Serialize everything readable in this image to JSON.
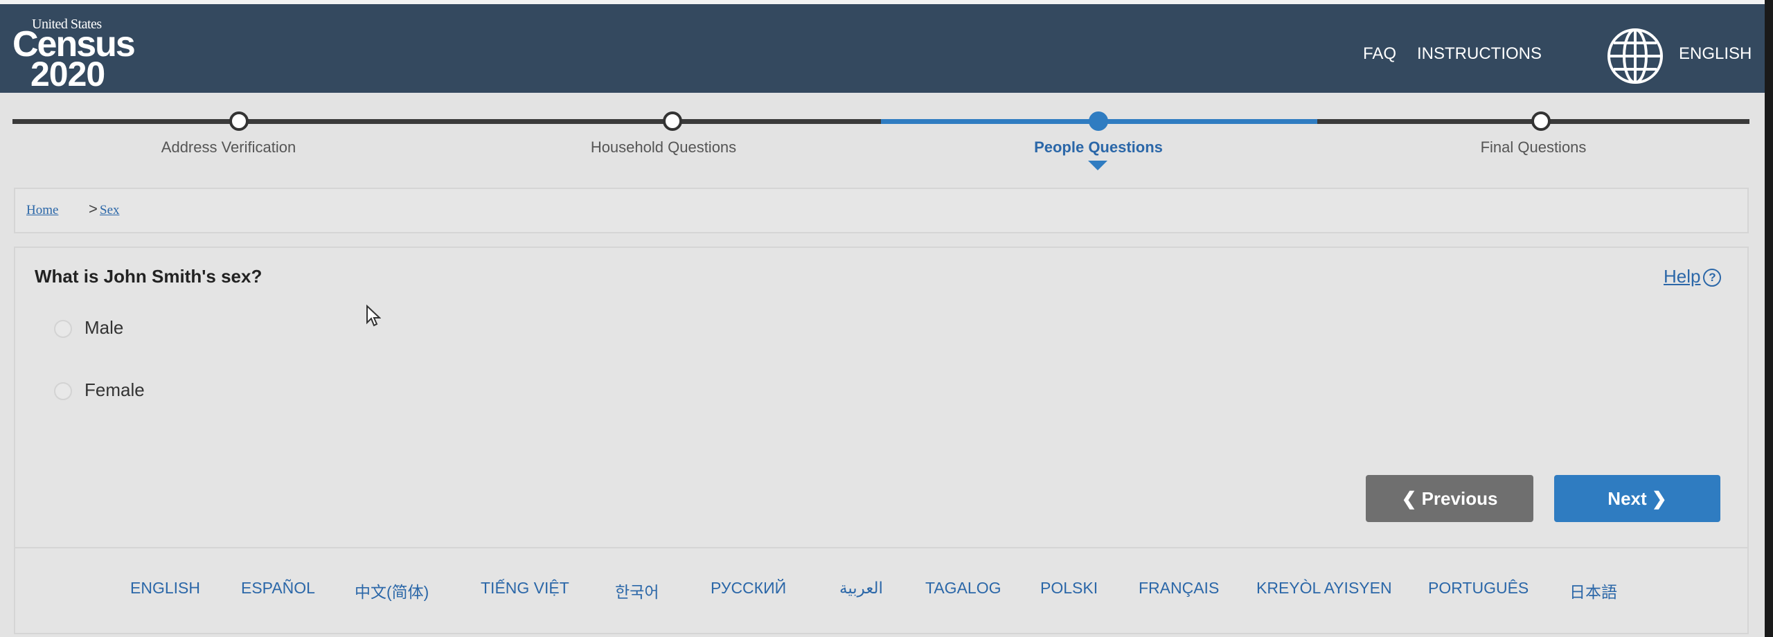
{
  "header": {
    "logo": {
      "line1": "United States",
      "line2": "Census",
      "line3": "2020"
    },
    "links": [
      "FAQ",
      "INSTRUCTIONS"
    ],
    "language_label": "ENGLISH",
    "globe_icon": "globe-icon"
  },
  "progress": {
    "steps": [
      {
        "label": "Address Verification",
        "state": "complete"
      },
      {
        "label": "Household Questions",
        "state": "complete"
      },
      {
        "label": "People Questions",
        "state": "current"
      },
      {
        "label": "Final Questions",
        "state": "upcoming"
      }
    ],
    "colors": {
      "complete": "#3a3a3a",
      "current": "#2f7cc1",
      "upcoming": "#3a3a3a"
    }
  },
  "breadcrumb": {
    "home": "Home",
    "separator": ">",
    "current": "Sex"
  },
  "question": {
    "text": "What is John Smith's sex?",
    "help_label": "Help",
    "options": [
      "Male",
      "Female"
    ]
  },
  "buttons": {
    "previous": "Previous",
    "next": "Next"
  },
  "languages": [
    "ENGLISH",
    "ESPAÑOL",
    "中文(简体)",
    "TIẾNG VIỆT",
    "한국어",
    "РУССКИЙ",
    "العربية",
    "TAGALOG",
    "POLSKI",
    "FRANÇAIS",
    "KREYÒL AYISYEN",
    "PORTUGUÊS",
    "日本語"
  ],
  "colors": {
    "header_bg": "#34495f",
    "accent": "#2f7cc1",
    "prev_button": "#6f6f6f"
  }
}
